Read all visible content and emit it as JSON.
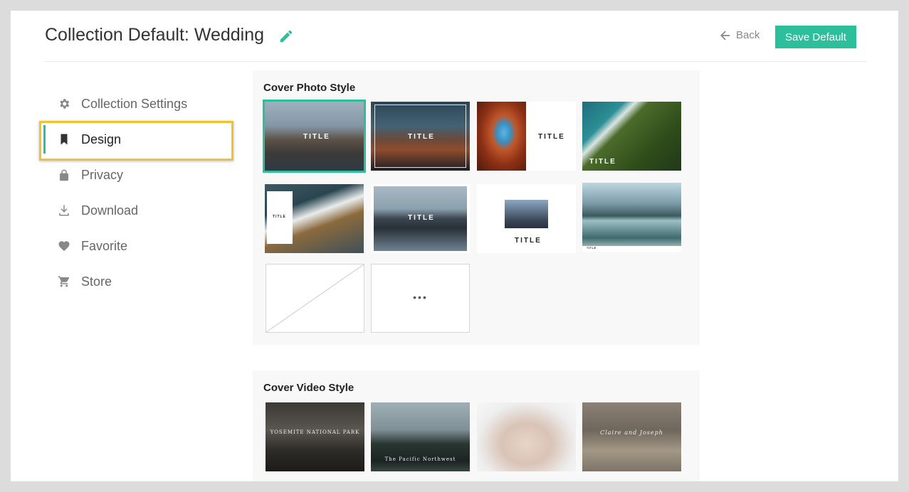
{
  "header": {
    "title": "Collection Default: Wedding",
    "back_label": "Back",
    "save_label": "Save Default"
  },
  "sidebar": {
    "items": [
      {
        "label": "Collection Settings",
        "icon": "gear-icon"
      },
      {
        "label": "Design",
        "icon": "bookmark-icon"
      },
      {
        "label": "Privacy",
        "icon": "lock-icon"
      },
      {
        "label": "Download",
        "icon": "download-icon"
      },
      {
        "label": "Favorite",
        "icon": "heart-icon"
      },
      {
        "label": "Store",
        "icon": "cart-icon"
      }
    ]
  },
  "cover_photo": {
    "title": "Cover Photo Style",
    "thumb_label": "TITLE",
    "more_label": "•••"
  },
  "cover_video": {
    "title": "Cover Video Style",
    "v1_text": "YOSEMITE NATIONAL PARK",
    "v2_text": "The Pacific Northwest",
    "v4_text": "Claire and Joseph"
  },
  "colors": {
    "accent": "#2bbf9b",
    "highlight": "#f2c12e"
  }
}
